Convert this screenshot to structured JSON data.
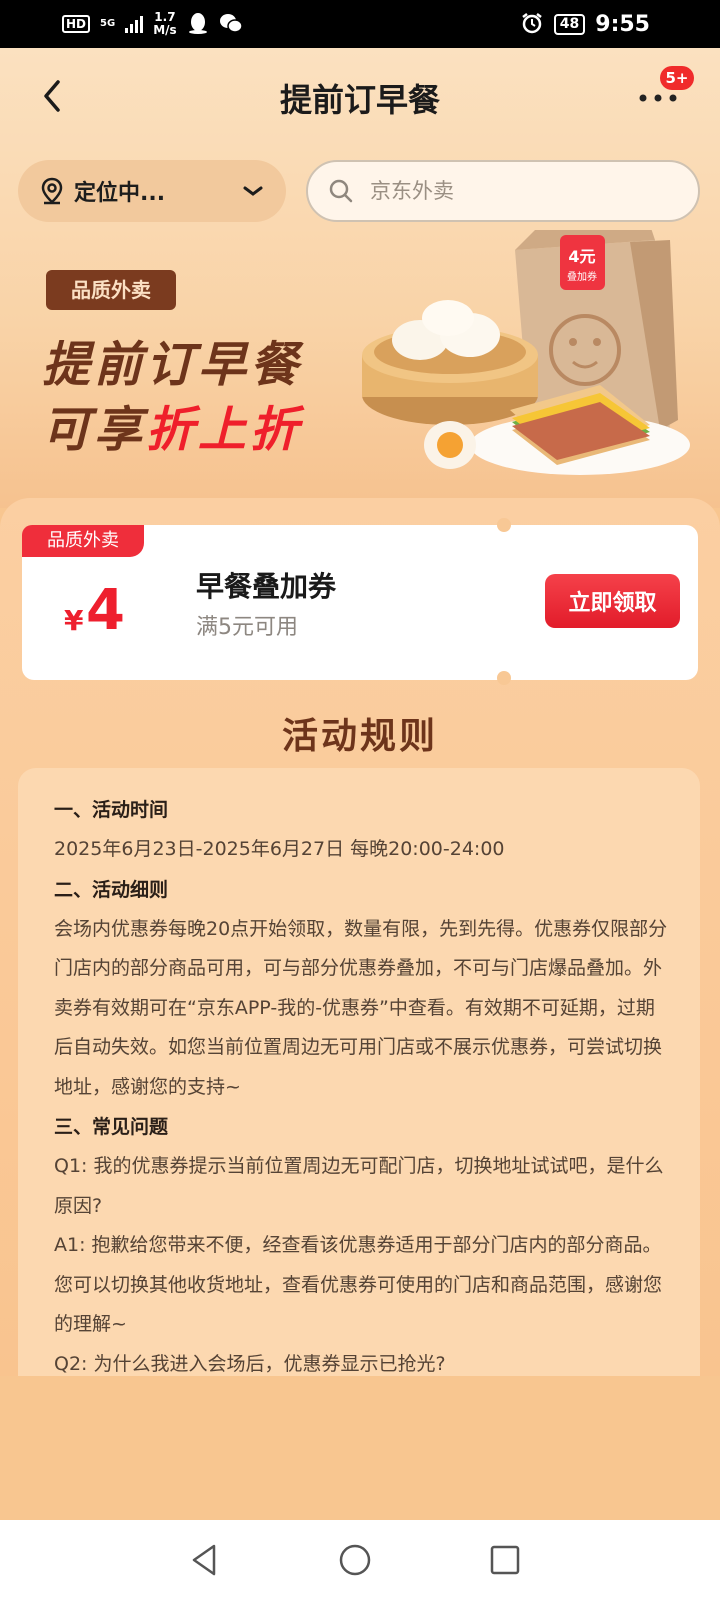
{
  "status_bar": {
    "hd": "HD",
    "network": "5G",
    "speed_top": "1.7",
    "speed_bottom": "M/s",
    "battery": "48",
    "time": "9:55"
  },
  "nav": {
    "title": "提前订早餐",
    "badge": "5+",
    "more": "..."
  },
  "location": {
    "label": "定位中..."
  },
  "search": {
    "placeholder": "京东外卖"
  },
  "hero": {
    "tag": "品质外卖",
    "line1": "提前订早餐",
    "line2_prefix": "可享",
    "line2_highlight": "折上折",
    "bag_label_amount": "4元",
    "bag_label_text": "叠加券"
  },
  "coupon": {
    "tag": "品质外卖",
    "currency": "¥",
    "amount": "4",
    "title": "早餐叠加券",
    "condition": "满5元可用",
    "button_label": "立即领取"
  },
  "rules": {
    "heading": "活动规则",
    "sec1_title": "一、活动时间",
    "sec1_body": "2025年6月23日-2025年6月27日 每晚20:00-24:00",
    "sec2_title": "二、活动细则",
    "sec2_body": "会场内优惠券每晚20点开始领取，数量有限，先到先得。优惠券仅限部分门店内的部分商品可用，可与部分优惠券叠加，不可与门店爆品叠加。外卖券有效期可在“京东APP-我的-优惠券”中查看。有效期不可延期，过期后自动失效。如您当前位置周边无可用门店或不展示优惠券，可尝试切换地址，感谢您的支持~",
    "sec3_title": "三、常见问题",
    "q1": "Q1: 我的优惠券提示当前位置周边无可配门店，切换地址试试吧，是什么原因?",
    "a1": "A1: 抱歉给您带来不便，经查看该优惠券适用于部分门店内的部分商品。您可以切换其他收货地址，查看优惠券可使用的门店和商品范围，感谢您的理解~",
    "q2": "Q2: 为什么我进入会场后，优惠券显示已抢光?"
  }
}
